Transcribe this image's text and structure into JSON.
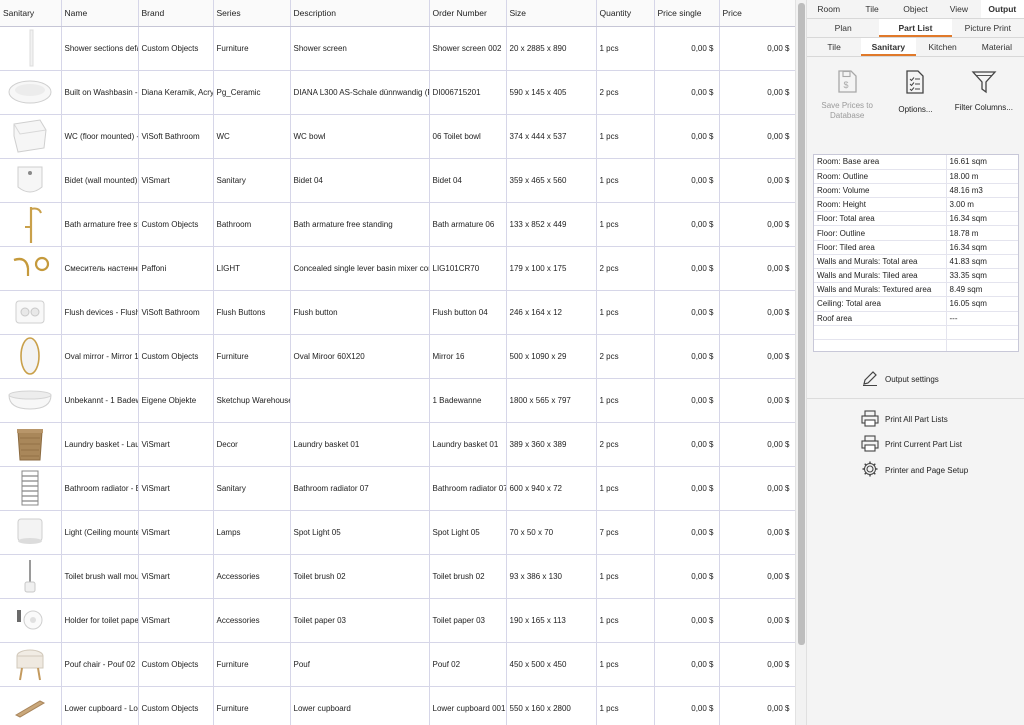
{
  "table": {
    "columns": [
      "Sanitary",
      "Name",
      "Brand",
      "Series",
      "Description",
      "Order Number",
      "Size",
      "Quantity",
      "Price single",
      "Price"
    ],
    "rows": [
      {
        "thumb": "shower-screen-icon",
        "name": "Shower sections defa",
        "brand": "Custom Objects",
        "series": "Furniture",
        "description": "Shower screen",
        "order": "Shower screen 002",
        "size": "20 x 2885 x 890",
        "qty": "1 pcs",
        "price_single": "0,00 $",
        "price": "0,00 $"
      },
      {
        "thumb": "washbasin-icon",
        "name": "Built on Washbasin -",
        "brand": "Diana Keramik, Acryl",
        "series": "Pg_Ceramic",
        "description": "DIANA L300 AS-Schale dünnwandig (F",
        "order": "DI006715201",
        "size": "590 x 145 x 405",
        "qty": "2 pcs",
        "price_single": "0,00 $",
        "price": "0,00 $"
      },
      {
        "thumb": "toilet-icon",
        "name": "WC (floor mounted) -",
        "brand": "ViSoft Bathroom",
        "series": "WC",
        "description": "WC bowl",
        "order": "06 Toilet bowl",
        "size": "374 x 444 x 537",
        "qty": "1 pcs",
        "price_single": "0,00 $",
        "price": "0,00 $"
      },
      {
        "thumb": "bidet-icon",
        "name": "Bidet (wall mounted)",
        "brand": "ViSmart",
        "series": "Sanitary",
        "description": "Bidet 04",
        "order": "Bidet 04",
        "size": "359 x 465 x 560",
        "qty": "1 pcs",
        "price_single": "0,00 $",
        "price": "0,00 $"
      },
      {
        "thumb": "bath-armature-icon",
        "name": "Bath armature free st",
        "brand": "Custom Objects",
        "series": "Bathroom",
        "description": "Bath armature free standing",
        "order": "Bath armature 06",
        "size": "133 x 852 x 449",
        "qty": "1 pcs",
        "price_single": "0,00 $",
        "price": "0,00 $"
      },
      {
        "thumb": "faucet-icon",
        "name": "Смеситель настенны",
        "brand": "Paffoni",
        "series": "LIGHT",
        "description": "Concealed single lever basin mixer cor",
        "order": "LIG101CR70",
        "size": "179 x 100 x 175",
        "qty": "2 pcs",
        "price_single": "0,00 $",
        "price": "0,00 $"
      },
      {
        "thumb": "flush-plate-icon",
        "name": "Flush devices - Flush",
        "brand": "ViSoft Bathroom",
        "series": "Flush Buttons",
        "description": "Flush button",
        "order": "Flush button 04",
        "size": "246 x 164 x 12",
        "qty": "1 pcs",
        "price_single": "0,00 $",
        "price": "0,00 $"
      },
      {
        "thumb": "oval-mirror-icon",
        "name": "Oval mirror - Mirror 1(",
        "brand": "Custom Objects",
        "series": "Furniture",
        "description": "Oval Miroor 60X120",
        "order": "Mirror 16",
        "size": "500 x 1090 x 29",
        "qty": "2 pcs",
        "price_single": "0,00 $",
        "price": "0,00 $"
      },
      {
        "thumb": "bathtub-icon",
        "name": "Unbekannt - 1 Badew",
        "brand": "Eigene Objekte",
        "series": "Sketchup Warehouse",
        "description": "",
        "order": "1 Badewanne",
        "size": "1800 x 565 x 797",
        "qty": "1 pcs",
        "price_single": "0,00 $",
        "price": "0,00 $"
      },
      {
        "thumb": "laundry-basket-icon",
        "name": "Laundry basket - Lau",
        "brand": "ViSmart",
        "series": "Decor",
        "description": "Laundry basket 01",
        "order": "Laundry basket 01",
        "size": "389 x 360 x 389",
        "qty": "2 pcs",
        "price_single": "0,00 $",
        "price": "0,00 $"
      },
      {
        "thumb": "radiator-icon",
        "name": "Bathroom radiator - E",
        "brand": "ViSmart",
        "series": "Sanitary",
        "description": "Bathroom radiator 07",
        "order": "Bathroom radiator 07",
        "size": "600 x 940 x 72",
        "qty": "1 pcs",
        "price_single": "0,00 $",
        "price": "0,00 $"
      },
      {
        "thumb": "spot-light-icon",
        "name": "Light (Ceiling mounte",
        "brand": "ViSmart",
        "series": "Lamps",
        "description": "Spot Light 05",
        "order": "Spot Light 05",
        "size": "70 x 50 x 70",
        "qty": "7 pcs",
        "price_single": "0,00 $",
        "price": "0,00 $"
      },
      {
        "thumb": "toilet-brush-icon",
        "name": "Toilet brush wall mou",
        "brand": "ViSmart",
        "series": "Accessories",
        "description": "Toilet brush 02",
        "order": "Toilet brush 02",
        "size": "93 x 386 x 130",
        "qty": "1 pcs",
        "price_single": "0,00 $",
        "price": "0,00 $"
      },
      {
        "thumb": "paper-holder-icon",
        "name": "Holder for toilet pape",
        "brand": "ViSmart",
        "series": "Accessories",
        "description": "Toilet paper 03",
        "order": "Toilet paper 03",
        "size": "190 x 165 x 113",
        "qty": "1 pcs",
        "price_single": "0,00 $",
        "price": "0,00 $"
      },
      {
        "thumb": "pouf-icon",
        "name": "Pouf chair - Pouf 02",
        "brand": "Custom Objects",
        "series": "Furniture",
        "description": "Pouf",
        "order": "Pouf 02",
        "size": "450 x 500 x 450",
        "qty": "1 pcs",
        "price_single": "0,00 $",
        "price": "0,00 $"
      },
      {
        "thumb": "cupboard-icon",
        "name": "Lower cupboard - Lo",
        "brand": "Custom Objects",
        "series": "Furniture",
        "description": "Lower cupboard",
        "order": "Lower cupboard 001",
        "size": "550 x 160 x 2800",
        "qty": "1 pcs",
        "price_single": "0,00 $",
        "price": "0,00 $"
      }
    ]
  },
  "panel": {
    "main_tabs": [
      "Room",
      "Tile",
      "Object",
      "View",
      "Output"
    ],
    "view_tabs": [
      "Plan",
      "Part List",
      "Picture Print"
    ],
    "sub_tabs": [
      "Tile",
      "Sanitary",
      "Kitchen",
      "Material"
    ],
    "actions": {
      "save_prices": "Save Prices to Database",
      "options": "Options...",
      "filter": "Filter Columns..."
    },
    "stats": [
      {
        "label": "Room: Base area",
        "value": "16.61 sqm"
      },
      {
        "label": "Room: Outline",
        "value": "18.00 m"
      },
      {
        "label": "Room: Volume",
        "value": "48.16 m3"
      },
      {
        "label": "Room: Height",
        "value": "3.00 m"
      },
      {
        "label": "Floor: Total area",
        "value": "16.34 sqm"
      },
      {
        "label": "Floor: Outline",
        "value": "18.78 m"
      },
      {
        "label": "Floor: Tiled area",
        "value": "16.34 sqm"
      },
      {
        "label": "Walls and Murals: Total area",
        "value": "41.83 sqm"
      },
      {
        "label": "Walls and Murals: Tiled area",
        "value": "33.35 sqm"
      },
      {
        "label": "Walls and Murals: Textured area",
        "value": "8.49 sqm"
      },
      {
        "label": "Ceiling: Total area",
        "value": "16.05 sqm"
      },
      {
        "label": "Roof area",
        "value": "---"
      },
      {
        "label": "",
        "value": ""
      },
      {
        "label": "",
        "value": ""
      }
    ],
    "output_settings": "Output settings",
    "print_all": "Print All Part Lists",
    "print_current": "Print Current Part List",
    "printer_setup": "Printer and Page Setup"
  },
  "colors": {
    "accent": "#e0792a"
  }
}
